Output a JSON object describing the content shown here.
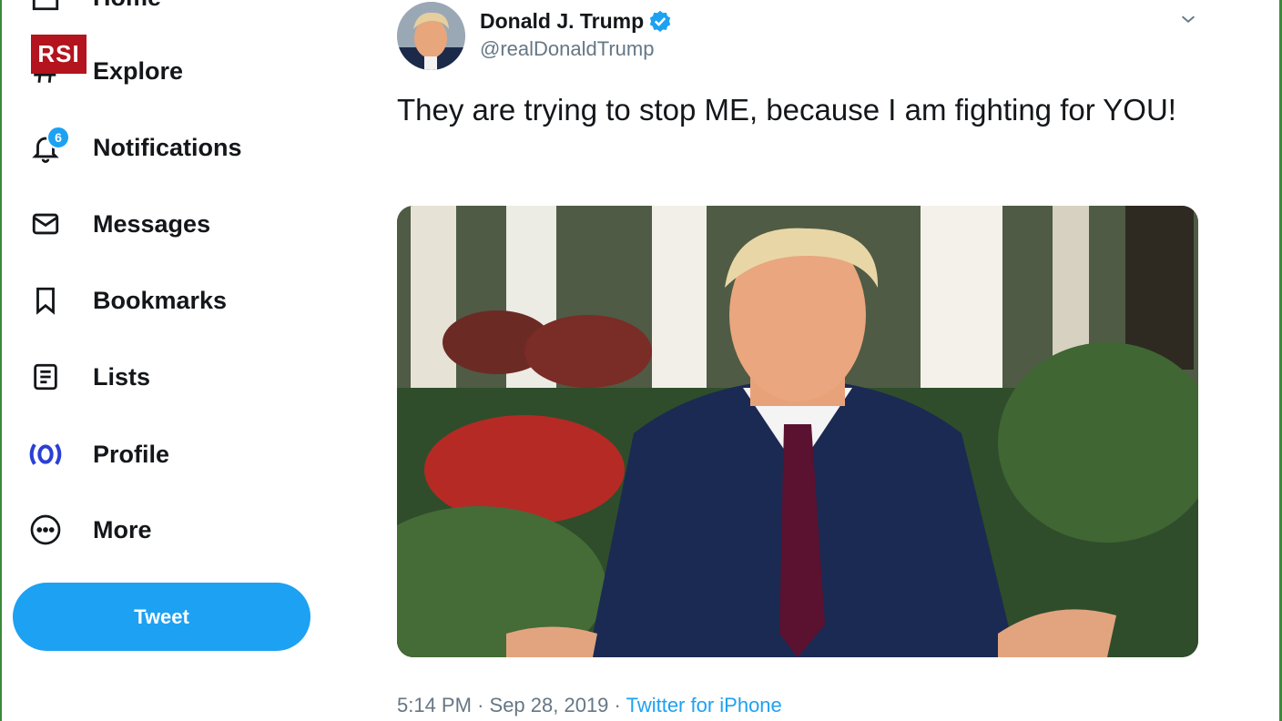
{
  "overlay": {
    "channel_logo": "RSI"
  },
  "sidebar": {
    "items": [
      {
        "label": "Home",
        "icon": "home-icon"
      },
      {
        "label": "Explore",
        "icon": "hashtag-icon"
      },
      {
        "label": "Notifications",
        "icon": "bell-icon",
        "badge": "6"
      },
      {
        "label": "Messages",
        "icon": "envelope-icon"
      },
      {
        "label": "Bookmarks",
        "icon": "bookmark-icon"
      },
      {
        "label": "Lists",
        "icon": "list-icon"
      },
      {
        "label": "Profile",
        "icon": "profile-icon"
      },
      {
        "label": "More",
        "icon": "more-icon"
      }
    ],
    "tweet_button": "Tweet"
  },
  "tweet": {
    "display_name": "Donald J. Trump",
    "handle": "@realDonaldTrump",
    "verified": true,
    "text": "They are trying to stop ME, because I am fighting for YOU!",
    "time": "5:14 PM",
    "date": "Sep 28, 2019",
    "separator": "·",
    "source": "Twitter for iPhone"
  },
  "colors": {
    "accent": "#1da1f2",
    "text_primary": "#14171a",
    "text_secondary": "#657786",
    "logo_red": "#b3141d"
  }
}
